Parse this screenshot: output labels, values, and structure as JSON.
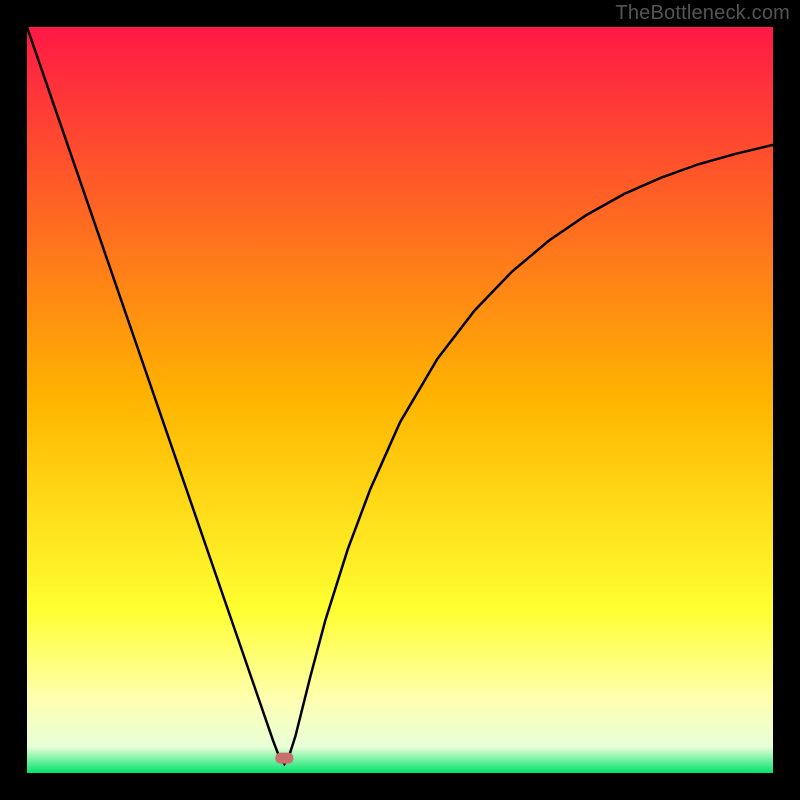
{
  "watermark": "TheBottleneck.com",
  "chart_data": {
    "type": "line",
    "title": "",
    "xlabel": "",
    "ylabel": "",
    "xlim": [
      0,
      100
    ],
    "ylim": [
      0,
      100
    ],
    "grid": false,
    "legend": false,
    "background_gradient_stops": [
      {
        "pos": 0.0,
        "color": "#ff1945"
      },
      {
        "pos": 0.5,
        "color": "#ffb500"
      },
      {
        "pos": 0.78,
        "color": "#ffff30"
      },
      {
        "pos": 0.9,
        "color": "#ffffb0"
      },
      {
        "pos": 0.965,
        "color": "#e8ffd8"
      },
      {
        "pos": 1.0,
        "color": "#00e36c"
      }
    ],
    "marker": {
      "x": 34.5,
      "y": 2.0,
      "color": "#c9706e"
    },
    "series": [
      {
        "name": "bottleneck-curve",
        "color": "#000000",
        "x": [
          0.0,
          2,
          4,
          6,
          8,
          10,
          12,
          14,
          16,
          18,
          20,
          22,
          24,
          26,
          28,
          30,
          31,
          32,
          33,
          33.8,
          34.5,
          35.2,
          36,
          37,
          38,
          40,
          43,
          46,
          50,
          55,
          60,
          65,
          70,
          75,
          80,
          85,
          90,
          95,
          100
        ],
        "y": [
          100,
          94.2,
          88.4,
          82.6,
          76.8,
          71.0,
          65.2,
          59.4,
          53.6,
          47.8,
          42.0,
          36.2,
          30.4,
          24.6,
          18.8,
          13.0,
          10.1,
          7.2,
          4.3,
          2.2,
          1.2,
          2.5,
          5.0,
          9.0,
          13.0,
          20.5,
          30.0,
          38.0,
          47.0,
          55.5,
          62.0,
          67.2,
          71.4,
          74.8,
          77.6,
          79.8,
          81.6,
          83.0,
          84.2
        ]
      }
    ]
  }
}
